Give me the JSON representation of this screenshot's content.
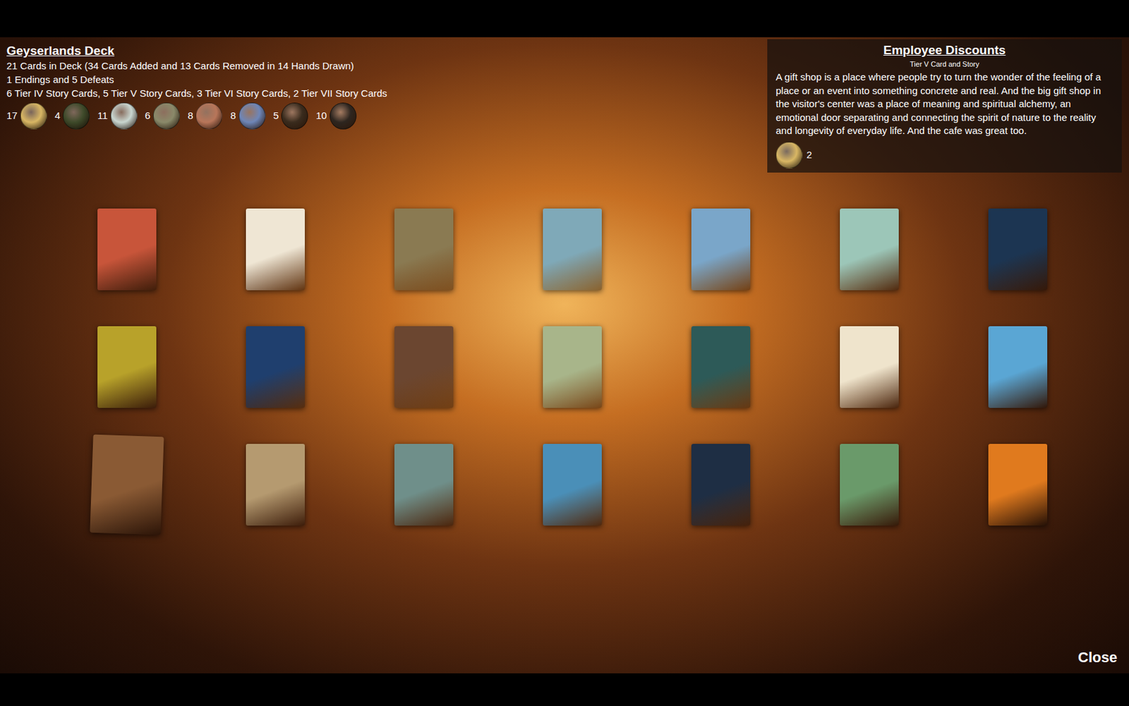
{
  "deck": {
    "title": "Geyserlands Deck",
    "lines": [
      "21 Cards in Deck (34 Cards Added and 13 Cards Removed in 14 Hands Drawn)",
      "1 Endings and 5 Defeats",
      "6 Tier IV Story Cards, 5 Tier V Story Cards, 3 Tier VI Story Cards, 2 Tier VII Story Cards"
    ]
  },
  "resources": [
    {
      "count": "17",
      "color": "#d9b764"
    },
    {
      "count": "4",
      "color": "#3e4a2a"
    },
    {
      "count": "11",
      "color": "#c9d6d0"
    },
    {
      "count": "6",
      "color": "#8a8a6a"
    },
    {
      "count": "8",
      "color": "#b8765a"
    },
    {
      "count": "8",
      "color": "#6e86b8"
    },
    {
      "count": "5",
      "color": "#3a2c1e"
    },
    {
      "count": "10",
      "color": "#2e2620"
    }
  ],
  "detail": {
    "title": "Employee Discounts",
    "subtitle": "Tier V Card and Story",
    "text": "A gift shop is a place where people try to turn the wonder of the feeling of a place or an event into something concrete and real.  And the big gift shop in the visitor's center was a place of meaning and spiritual alchemy, an emotional door separating and connecting the spirit of nature to the reality and longevity of everyday life.  And the cafe was great too.",
    "cost": {
      "count": "2",
      "color": "#d9b764"
    }
  },
  "cards": [
    {
      "color": "#c8553a",
      "hovered": false
    },
    {
      "color": "#efe6d4",
      "hovered": false
    },
    {
      "color": "#8a7a52",
      "hovered": false
    },
    {
      "color": "#7fa9b8",
      "hovered": false
    },
    {
      "color": "#7aa6c9",
      "hovered": false
    },
    {
      "color": "#9cc6b8",
      "hovered": false
    },
    {
      "color": "#1c3552",
      "hovered": false
    },
    {
      "color": "#b8a22a",
      "hovered": false
    },
    {
      "color": "#1f3f6e",
      "hovered": false
    },
    {
      "color": "#6b4630",
      "hovered": false
    },
    {
      "color": "#a8b58a",
      "hovered": false
    },
    {
      "color": "#2d5a58",
      "hovered": false
    },
    {
      "color": "#efe4cc",
      "hovered": false
    },
    {
      "color": "#5aa6d4",
      "hovered": false
    },
    {
      "color": "#8a5a34",
      "hovered": true
    },
    {
      "color": "#b59a70",
      "hovered": false
    },
    {
      "color": "#6f8f8a",
      "hovered": false
    },
    {
      "color": "#4a8fb8",
      "hovered": false
    },
    {
      "color": "#1e2e44",
      "hovered": false
    },
    {
      "color": "#6a9a6a",
      "hovered": false
    },
    {
      "color": "#e07a1e",
      "hovered": false
    }
  ],
  "buttons": [
    "Close"
  ]
}
